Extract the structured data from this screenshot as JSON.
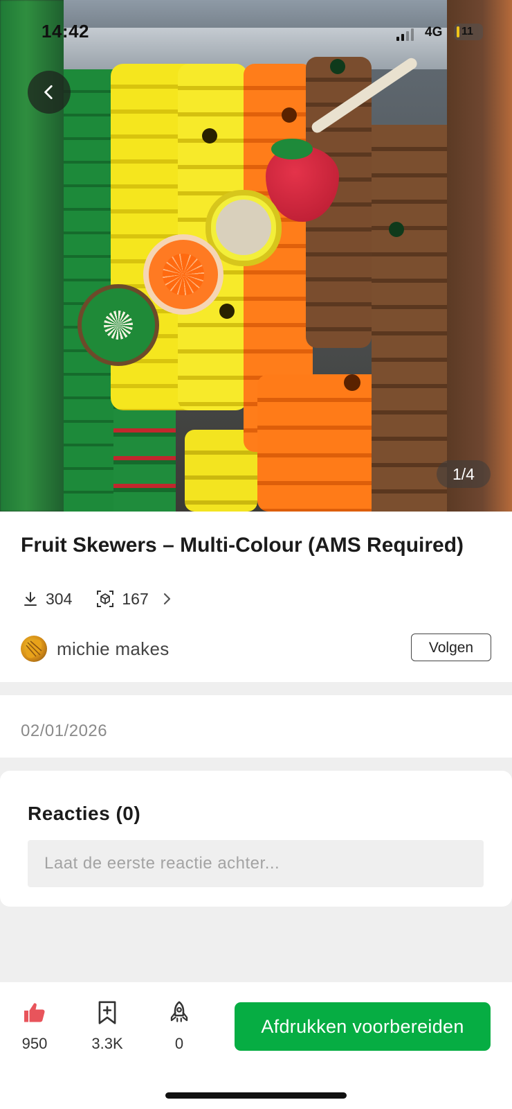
{
  "status_bar": {
    "time": "14:42",
    "network": "4G",
    "battery": "11"
  },
  "gallery": {
    "page_indicator": "1/4"
  },
  "model": {
    "title": "Fruit Skewers – Multi-Colour (AMS Required)",
    "downloads": "304",
    "prints": "167"
  },
  "author": {
    "name": "michie makes",
    "follow_label": "Volgen"
  },
  "date": "02/01/2026",
  "comments": {
    "title": "Reacties (0)",
    "placeholder": "Laat de eerste reactie achter..."
  },
  "actions": {
    "likes": "950",
    "collects": "3.3K",
    "boosts": "0",
    "print_label": "Afdrukken voorbereiden"
  },
  "colors": {
    "accent": "#06ad43",
    "like": "#e8545b"
  },
  "icons": [
    "back-arrow-icon",
    "download-icon",
    "cube-scan-icon",
    "chevron-right-icon",
    "thumbs-up-icon",
    "bookmark-plus-icon",
    "rocket-icon"
  ]
}
